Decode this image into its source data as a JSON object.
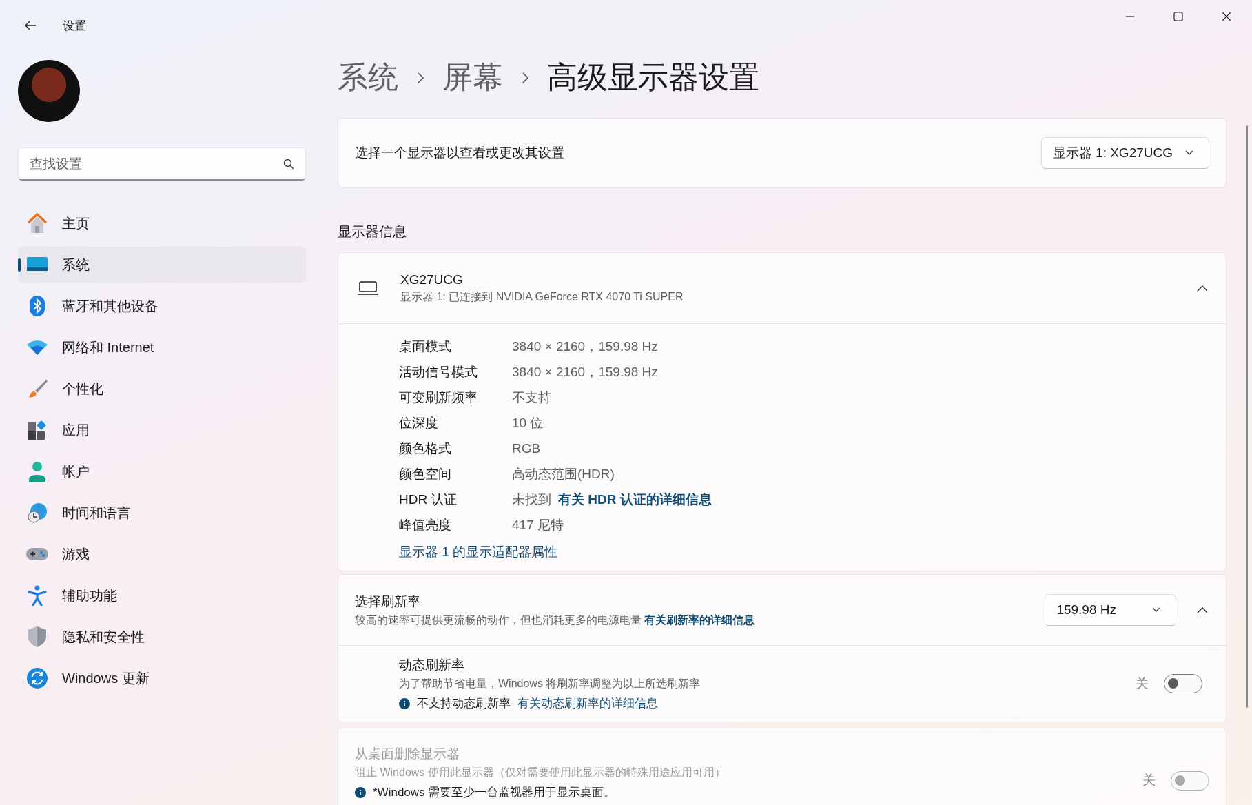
{
  "window": {
    "title": "设置"
  },
  "search": {
    "placeholder": "查找设置"
  },
  "nav": [
    {
      "label": "主页",
      "kind": "home",
      "selected": false
    },
    {
      "label": "系统",
      "kind": "system",
      "selected": true
    },
    {
      "label": "蓝牙和其他设备",
      "kind": "bluetooth",
      "selected": false
    },
    {
      "label": "网络和 Internet",
      "kind": "network",
      "selected": false
    },
    {
      "label": "个性化",
      "kind": "brush",
      "selected": false
    },
    {
      "label": "应用",
      "kind": "apps",
      "selected": false
    },
    {
      "label": "帐户",
      "kind": "account",
      "selected": false
    },
    {
      "label": "时间和语言",
      "kind": "time",
      "selected": false
    },
    {
      "label": "游戏",
      "kind": "gaming",
      "selected": false
    },
    {
      "label": "辅助功能",
      "kind": "accessibility",
      "selected": false
    },
    {
      "label": "隐私和安全性",
      "kind": "privacy",
      "selected": false
    },
    {
      "label": "Windows 更新",
      "kind": "update",
      "selected": false
    }
  ],
  "breadcrumb": [
    "系统",
    "屏幕",
    "高级显示器设置"
  ],
  "display_picker": {
    "label": "选择一个显示器以查看或更改其设置",
    "value": "显示器 1: XG27UCG"
  },
  "display_info": {
    "heading": "显示器信息",
    "name": "XG27UCG",
    "subtitle": "显示器 1: 已连接到 NVIDIA GeForce RTX 4070 Ti SUPER",
    "expanded": true,
    "rows": [
      {
        "label": "桌面模式",
        "value": "3840 × 2160，159.98 Hz"
      },
      {
        "label": "活动信号模式",
        "value": "3840 × 2160，159.98 Hz"
      },
      {
        "label": "可变刷新频率",
        "value": "不支持"
      },
      {
        "label": "位深度",
        "value": "10 位"
      },
      {
        "label": "颜色格式",
        "value": "RGB"
      },
      {
        "label": "颜色空间",
        "value": "高动态范围(HDR)"
      },
      {
        "label": "HDR 认证",
        "value": "未找到",
        "link": "有关 HDR 认证的详细信息"
      },
      {
        "label": "峰值亮度",
        "value": "417 尼特"
      }
    ],
    "adapter_link": "显示器 1 的显示适配器属性"
  },
  "refresh_rate": {
    "title": "选择刷新率",
    "description": "较高的速率可提供更流畅的动作，但也消耗更多的电源电量",
    "link": "有关刷新率的详细信息",
    "value": "159.98 Hz",
    "expanded": true,
    "dynamic": {
      "title": "动态刷新率",
      "description": "为了帮助节省电量，Windows 将刷新率调整为以上所选刷新率",
      "note": "不支持动态刷新率",
      "note_link": "有关动态刷新率的详细信息",
      "toggle_label": "关",
      "on": false
    }
  },
  "remove_display": {
    "title": "从桌面删除显示器",
    "description": "阻止 Windows 使用此显示器（仅对需要使用此显示器的特殊用途应用可用）",
    "note": "*Windows 需要至少一台监视器用于显示桌面。",
    "toggle_label": "关",
    "on": false,
    "disabled": true
  }
}
